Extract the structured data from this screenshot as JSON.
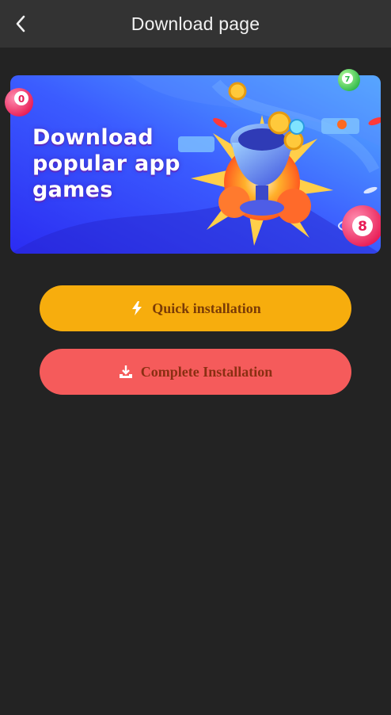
{
  "header": {
    "title": "Download page",
    "back_icon": "chevron-left-icon"
  },
  "banner": {
    "headline_line1": "Download",
    "headline_line2": "popular app",
    "headline_line3": "games",
    "ball_numbers": [
      "0",
      "7",
      "8"
    ],
    "colors": {
      "bg_start": "#2d3dff",
      "bg_end": "#4fa8ff",
      "trophy": "#4a6cff"
    }
  },
  "actions": {
    "quick_label": "Quick installation",
    "quick_icon": "lightning-icon",
    "complete_label": "Complete Installation",
    "complete_icon": "download-tray-icon"
  },
  "colors": {
    "page_bg": "#232323",
    "header_bg": "#333333",
    "quick_bg": "#f7ad0d",
    "complete_bg": "#f55b5b"
  }
}
